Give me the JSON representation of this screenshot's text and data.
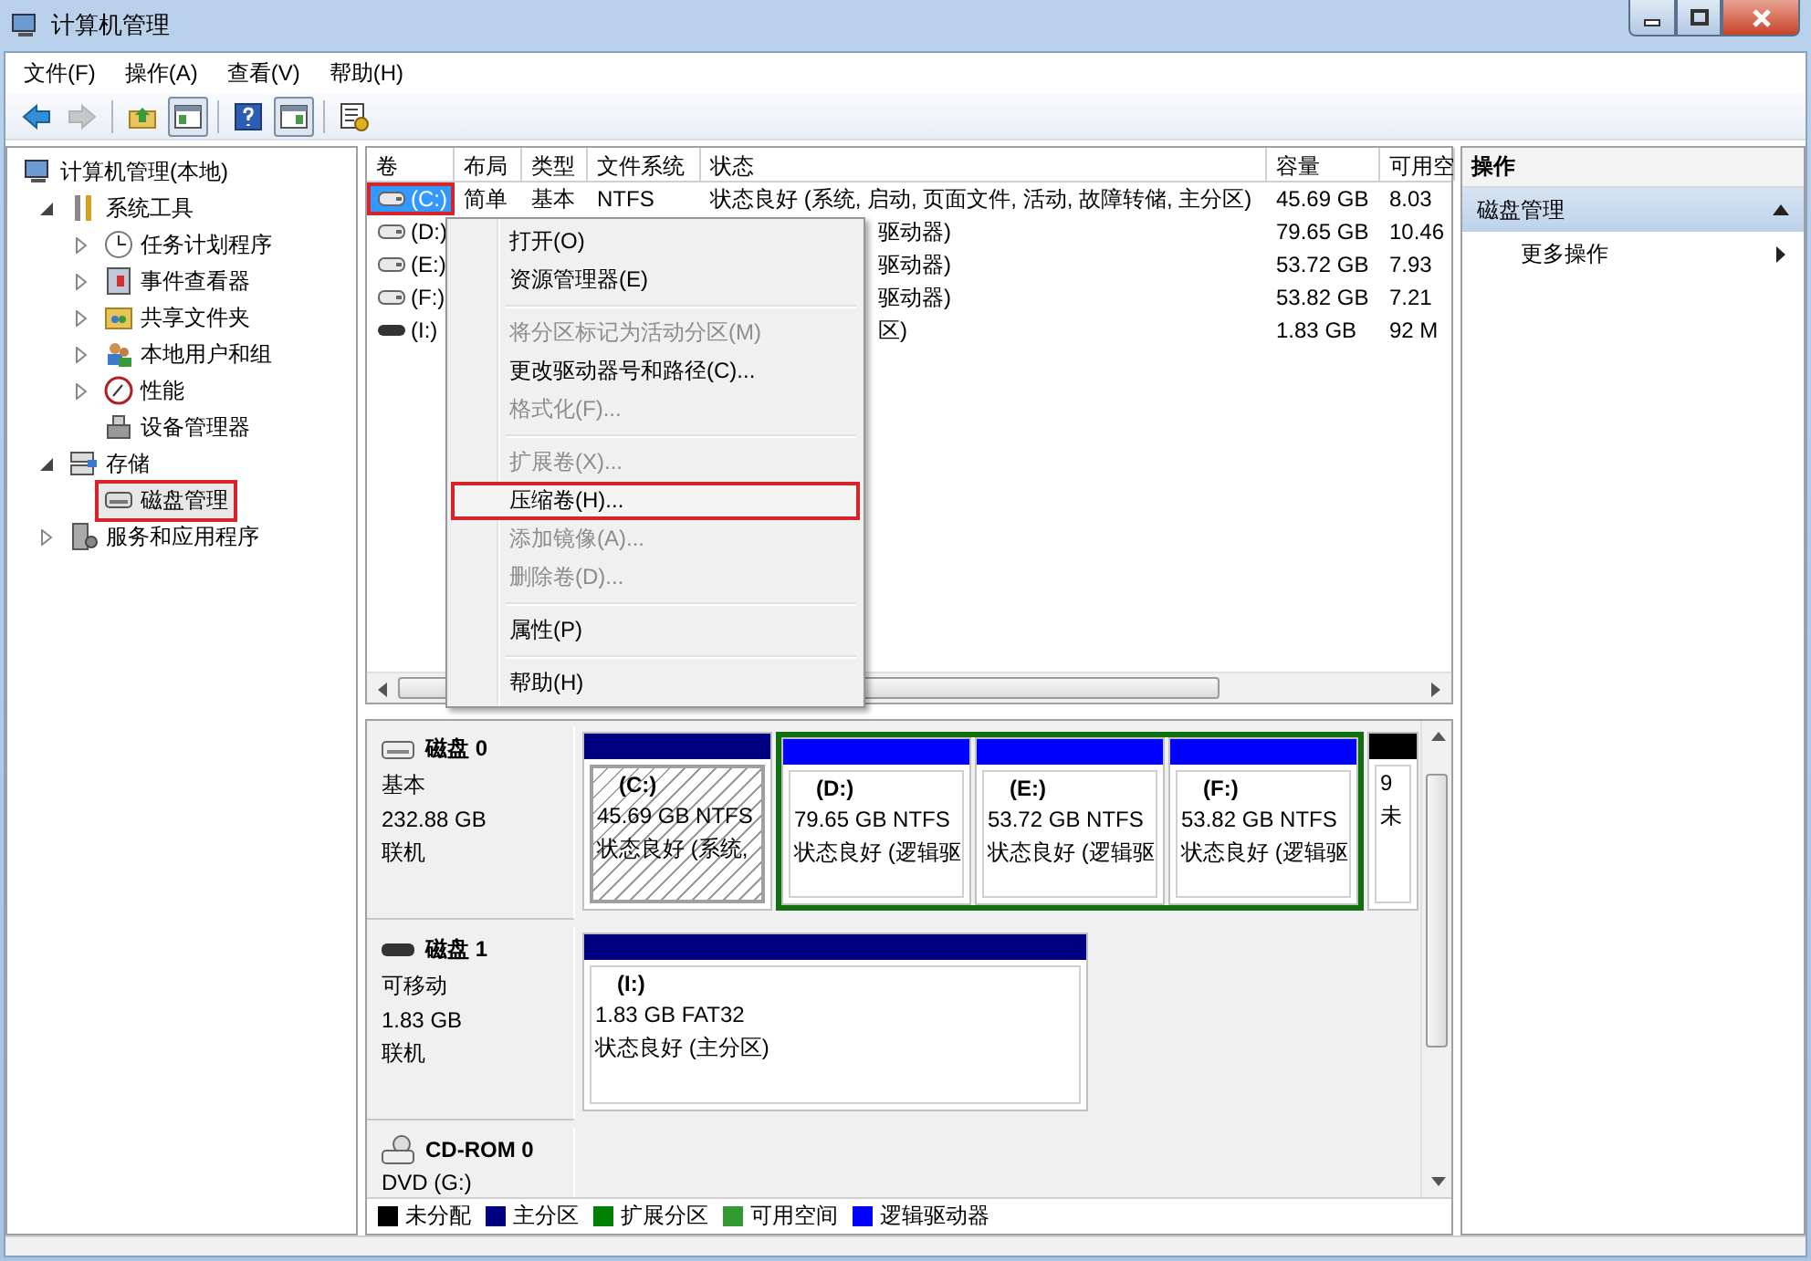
{
  "window": {
    "title": "计算机管理"
  },
  "menu": [
    "文件(F)",
    "操作(A)",
    "查看(V)",
    "帮助(H)"
  ],
  "toolbar": [
    {
      "kind": "back",
      "disabled": false
    },
    {
      "kind": "forward",
      "disabled": true
    },
    {
      "kind": "sep"
    },
    {
      "kind": "up",
      "disabled": false
    },
    {
      "kind": "tree",
      "pressed": true
    },
    {
      "kind": "sep"
    },
    {
      "kind": "help",
      "disabled": false
    },
    {
      "kind": "pane",
      "pressed": true
    },
    {
      "kind": "sep"
    },
    {
      "kind": "props",
      "disabled": false
    }
  ],
  "tree": [
    {
      "label": "计算机管理(本地)",
      "selected": false,
      "marked": false,
      "children": [
        {
          "label": "系统工具",
          "expanded": true,
          "selected": false,
          "marked": false,
          "children": [
            {
              "label": "任务计划程序",
              "expanded": false,
              "selected": false,
              "marked": false
            },
            {
              "label": "事件查看器",
              "expanded": false,
              "selected": false,
              "marked": false
            },
            {
              "label": "共享文件夹",
              "expanded": false,
              "selected": false,
              "marked": false
            },
            {
              "label": "本地用户和组",
              "expanded": false,
              "selected": false,
              "marked": false
            },
            {
              "label": "性能",
              "expanded": false,
              "selected": false,
              "marked": false
            },
            {
              "label": "设备管理器",
              "selected": false,
              "marked": false
            }
          ]
        },
        {
          "label": "存储",
          "expanded": true,
          "selected": false,
          "marked": false,
          "children": [
            {
              "label": "磁盘管理",
              "selected": true,
              "marked": true
            }
          ]
        },
        {
          "label": "服务和应用程序",
          "expanded": false,
          "selected": false,
          "marked": false
        }
      ]
    }
  ],
  "volumes": {
    "columns": [
      "卷",
      "布局",
      "类型",
      "文件系统",
      "状态",
      "容量",
      "可用空"
    ],
    "rows": [
      {
        "volume": "(C:)",
        "layout": "简单",
        "type": "基本",
        "fs": "NTFS",
        "status": "状态良好 (系统, 启动, 页面文件, 活动, 故障转储, 主分区)",
        "capacity": "45.69 GB",
        "free": "8.03",
        "selected": true,
        "marked": true,
        "removable": false,
        "covered": false
      },
      {
        "volume": "(D:)",
        "status": "驱动器)",
        "capacity": "79.65 GB",
        "free": "10.46",
        "selected": false,
        "marked": false,
        "removable": false,
        "covered": true
      },
      {
        "volume": "(E:)",
        "status": "驱动器)",
        "capacity": "53.72 GB",
        "free": "7.93",
        "selected": false,
        "marked": false,
        "removable": false,
        "covered": true
      },
      {
        "volume": "(F:)",
        "status": "驱动器)",
        "capacity": "53.82 GB",
        "free": "7.21",
        "selected": false,
        "marked": false,
        "removable": false,
        "covered": true
      },
      {
        "volume": "(I:)",
        "status": "区)",
        "capacity": "1.83 GB",
        "free": "92 M",
        "selected": false,
        "marked": false,
        "removable": true,
        "covered": true
      }
    ]
  },
  "context_menu": [
    {
      "kind": "item",
      "label": "打开(O)",
      "disabled": false,
      "marked": false
    },
    {
      "kind": "item",
      "label": "资源管理器(E)",
      "disabled": false,
      "marked": false
    },
    {
      "kind": "separator"
    },
    {
      "kind": "item",
      "label": "将分区标记为活动分区(M)",
      "disabled": true,
      "marked": false
    },
    {
      "kind": "item",
      "label": "更改驱动器号和路径(C)...",
      "disabled": false,
      "marked": false
    },
    {
      "kind": "item",
      "label": "格式化(F)...",
      "disabled": true,
      "marked": false
    },
    {
      "kind": "separator"
    },
    {
      "kind": "item",
      "label": "扩展卷(X)...",
      "disabled": true,
      "marked": false
    },
    {
      "kind": "item",
      "label": "压缩卷(H)...",
      "disabled": false,
      "marked": true
    },
    {
      "kind": "item",
      "label": "添加镜像(A)...",
      "disabled": true,
      "marked": false
    },
    {
      "kind": "item",
      "label": "删除卷(D)...",
      "disabled": true,
      "marked": false
    },
    {
      "kind": "separator"
    },
    {
      "kind": "item",
      "label": "属性(P)",
      "disabled": false,
      "marked": false
    },
    {
      "kind": "separator"
    },
    {
      "kind": "item",
      "label": "帮助(H)",
      "disabled": false,
      "marked": false
    }
  ],
  "disks": [
    {
      "kind": "disk",
      "name": "磁盘 0",
      "type": "基本",
      "size": "232.88 GB",
      "state": "联机",
      "partitions": [
        {
          "kind": "primary",
          "label": "(C:)",
          "size": "45.69 GB NTFS",
          "status": "状态良好 (系统,",
          "selected": true
        },
        {
          "kind": "extended",
          "children": [
            {
              "kind": "logical",
              "label": "(D:)",
              "size": "79.65 GB NTFS",
              "status": "状态良好 (逻辑驱",
              "selected": false
            },
            {
              "kind": "logical",
              "label": "(E:)",
              "size": "53.72 GB NTFS",
              "status": "状态良好 (逻辑驱",
              "selected": false
            },
            {
              "kind": "logical",
              "label": "(F:)",
              "size": "53.82 GB NTFS",
              "status": "状态良好 (逻辑驱",
              "selected": false
            }
          ]
        },
        {
          "kind": "unallocated",
          "size": "9",
          "status": "未",
          "selected": false
        }
      ]
    },
    {
      "kind": "removable",
      "name": "磁盘 1",
      "type": "可移动",
      "size": "1.83 GB",
      "state": "联机",
      "partitions": [
        {
          "kind": "primary",
          "label": "(I:)",
          "size": "1.83 GB FAT32",
          "status": "状态良好 (主分区)",
          "selected": false,
          "wide": true
        }
      ]
    },
    {
      "kind": "cdrom",
      "name": "CD-ROM 0",
      "type": "DVD (G:)"
    }
  ],
  "legend": [
    {
      "label": "未分配",
      "color": "#000000"
    },
    {
      "label": "主分区",
      "color": "#000080"
    },
    {
      "label": "扩展分区",
      "color": "#008000"
    },
    {
      "label": "可用空间",
      "color": "#339933"
    },
    {
      "label": "逻辑驱动器",
      "color": "#0000ff"
    }
  ],
  "actions": {
    "title": "操作",
    "section": "磁盘管理",
    "expanded": true,
    "items": [
      "更多操作"
    ]
  }
}
